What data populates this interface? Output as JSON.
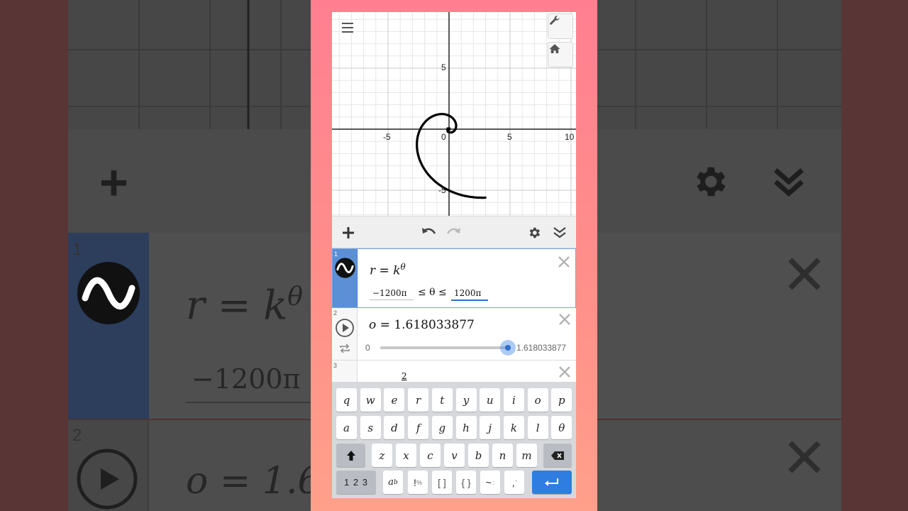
{
  "graph": {
    "x_ticks": [
      {
        "label": "-5"
      },
      {
        "label": "0"
      },
      {
        "label": "5"
      },
      {
        "label": "10"
      }
    ],
    "y_ticks": [
      {
        "label": "5"
      },
      {
        "label": "-5"
      }
    ],
    "curve_color": "#000000",
    "buttons": {
      "settings_icon": "wrench-icon",
      "home_icon": "home-icon",
      "menu_icon": "hamburger-menu-icon"
    }
  },
  "toolbar": {
    "add_icon": "plus-icon",
    "undo_icon": "undo-icon",
    "redo_icon": "redo-icon",
    "settings_icon": "gear-icon",
    "collapse_icon": "double-chevron-down-icon"
  },
  "expressions": [
    {
      "index": "1",
      "lhs": "r",
      "eq": "=",
      "base": "k",
      "exponent": "θ",
      "domain_min": "−1200π",
      "domain_rel": "≤ θ ≤",
      "domain_max": "1200π",
      "accent_color": "#5b8fd6"
    },
    {
      "index": "2",
      "lhs": "o",
      "eq": "=",
      "value": "1.618033877",
      "slider_min": "0",
      "slider_max": "1.618033877",
      "slider_fraction": 1.0
    },
    {
      "index": "3",
      "partial": "2"
    }
  ],
  "keyboard": {
    "row1": [
      "q",
      "w",
      "e",
      "r",
      "t",
      "y",
      "u",
      "i",
      "o",
      "p"
    ],
    "row2": [
      "a",
      "s",
      "d",
      "f",
      "g",
      "h",
      "j",
      "k",
      "l",
      "θ"
    ],
    "row3": [
      "z",
      "x",
      "c",
      "v",
      "b",
      "n",
      "m"
    ],
    "numbers_key": "1 2 3",
    "subscript_base": "a",
    "subscript_sub": "b",
    "factorial_key": "!",
    "percent_key": "%",
    "brackets_key": "[ ]",
    "braces_key": "{ }",
    "tilde_key": "~",
    "colon_key": ":",
    "comma_key": ",",
    "prime_key": "′",
    "enter_color": "#2f7de1"
  },
  "background": {
    "big_expr1_lhs": "r = k",
    "big_expr1_exp": "θ",
    "big_expr1_min": "−1200π",
    "big_expr2": "o = 1.6",
    "big_index1": "1",
    "big_index2": "2"
  }
}
